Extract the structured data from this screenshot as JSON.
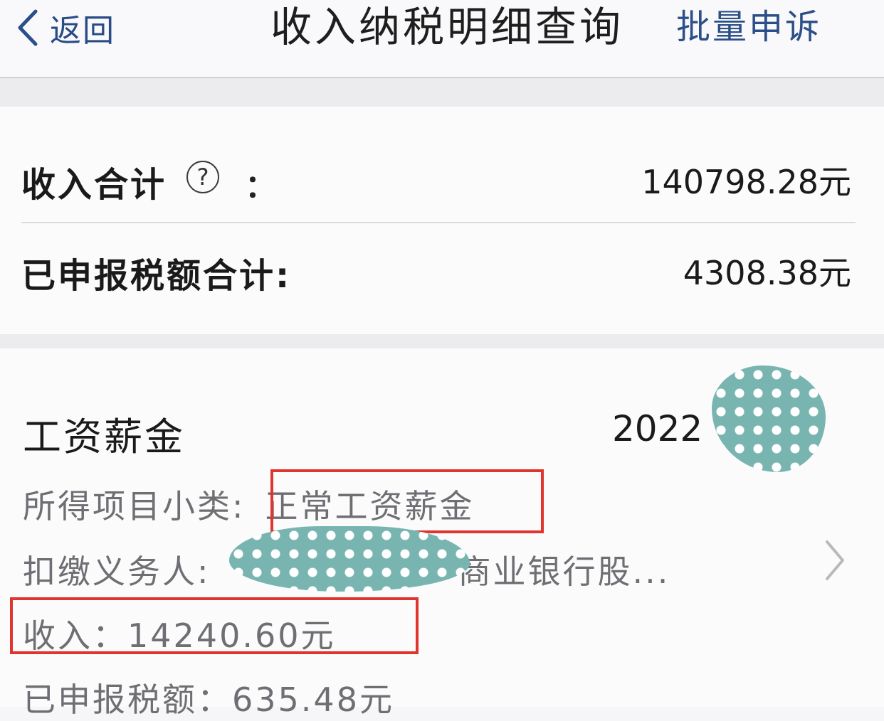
{
  "navbar": {
    "back_label": "返回",
    "title": "收入纳税明细查询",
    "right_action": "批量申诉"
  },
  "summary": {
    "income_total_label": "收入合计",
    "income_total_separator": "：",
    "income_total_value": "140798.28元",
    "declared_tax_total_label": "已申报税额合计:",
    "declared_tax_total_value": "4308.38元"
  },
  "record": {
    "title": "工资薪金",
    "date_partial": "2022",
    "subcategory_label": "所得项目小类:",
    "subcategory_value": "正常工资薪金",
    "withholder_label": "扣缴义务人:",
    "withholder_value": "商业银行股...",
    "income_label": "收入：",
    "income_value": "14240.60元",
    "declared_tax_label": "已申报税额：",
    "declared_tax_value": "635.48元"
  },
  "colors": {
    "accent": "#2c4f88",
    "highlight": "#e0342f",
    "redaction": "#79b5b0"
  },
  "icons": {
    "back": "chevron-left-icon",
    "help": "question-circle-icon",
    "detail": "chevron-right-icon"
  }
}
